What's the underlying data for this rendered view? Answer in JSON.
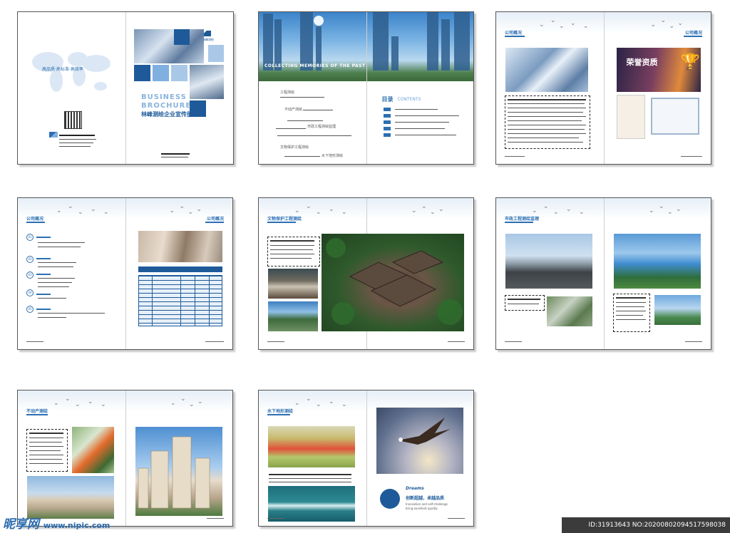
{
  "cover": {
    "slogan": "高品质·高标准·高效率",
    "business": "BUSINESS",
    "brochure": "BROCHURE",
    "subtitle": "林峰测绘企业宣传册",
    "logo_text": "林峰测绘"
  },
  "toc": {
    "banner_title": "COLLECTING MEMORIES OF THE PAST",
    "items": [
      "工程测绘",
      "不动产测绘",
      "市政工程测绘监理",
      "文物保护工程测绘",
      "水下地形测绘"
    ],
    "heading": "目录",
    "heading_en": "CONTENTS",
    "entries": [
      "01",
      "02",
      "03",
      "04",
      "05"
    ]
  },
  "company_profile": {
    "title": "公司概况",
    "title_right": "公司概况",
    "honor_banner": "荣誉资质"
  },
  "profile2": {
    "title": "公司概况",
    "title_right": "公司概况",
    "numbers": [
      "01",
      "02",
      "03",
      "04",
      "05"
    ]
  },
  "heritage": {
    "title": "文物保护工程测绘"
  },
  "municipal": {
    "title": "市政工程测绘监理"
  },
  "realestate": {
    "title": "不动产测绘"
  },
  "underwater": {
    "title": "水下地形测绘"
  },
  "dreams": {
    "word": "Dreams",
    "cn": "创新超越，卓越品质",
    "en1": "Innovation and self-challenge",
    "en2": "bring excellent quality"
  },
  "watermark": {
    "left_cn": "昵享网",
    "left_url": "www.nipic.com",
    "right": "ID:31913643 NO:20200802094517598038"
  },
  "colors": {
    "accent": "#2c6fb3",
    "light_blue": "#a9c8e8",
    "dark_blue": "#1e5a99"
  }
}
